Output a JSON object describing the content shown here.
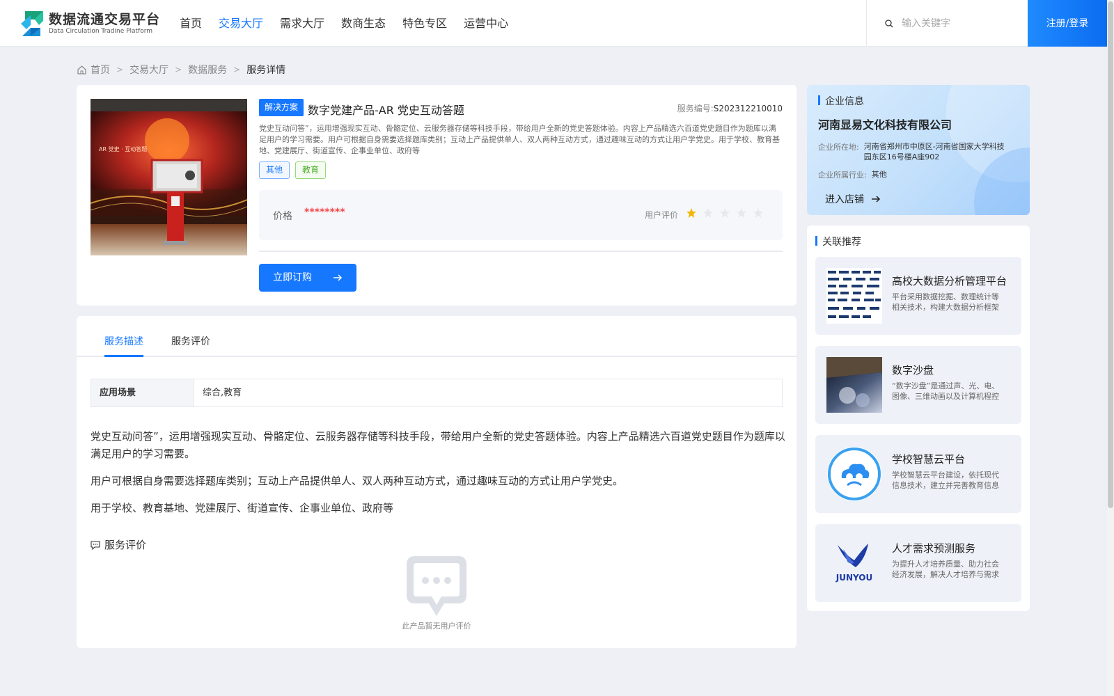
{
  "header": {
    "logo_title": "数据流通交易平台",
    "logo_subtitle": "Data Circulation Tradine Platform",
    "nav": [
      "首页",
      "交易大厅",
      "需求大厅",
      "数商生态",
      "特色专区",
      "运营中心"
    ],
    "active_nav": "交易大厅",
    "search_placeholder": "输入关键字",
    "login_label": "注册/登录"
  },
  "breadcrumb": [
    "首页",
    "交易大厅",
    "数据服务",
    "服务详情"
  ],
  "product": {
    "badge": "解决方案",
    "title": "数字党建产品-AR 党史互动答题",
    "code_label": "服务编号:",
    "code": "S202312210010",
    "description": "党史互动问答”，运用增强现实互动、骨骼定位、云服务器存储等科技手段，带给用户全新的党史答题体验。内容上产品精选六百道党史题目作为题库以满足用户的学习需要。用户可根据自身需要选择题库类别；互动上产品提供单人、双人两种互动方式，通过趣味互动的方式让用户学党史。用于学校、教育基地、党建展厅、街道宣传、企事业单位、政府等",
    "tags": [
      "其他",
      "教育"
    ],
    "price_label": "价格",
    "price": "********",
    "rating_label": "用户评价",
    "rating": 1,
    "rating_max": 5,
    "buy_label": "立即订购"
  },
  "detail": {
    "tabs": [
      "服务描述",
      "服务评价"
    ],
    "active_tab": "服务描述",
    "scene_label": "应用场景",
    "scene_value": "综合,教育",
    "paragraphs": [
      "党史互动问答”，运用增强现实互动、骨骼定位、云服务器存储等科技手段，带给用户全新的党史答题体验。内容上产品精选六百道党史题目作为题库以满足用户的学习需要。",
      "用户可根据自身需要选择题库类别；互动上产品提供单人、双人两种互动方式，通过趣味互动的方式让用户学党史。",
      "用于学校、教育基地、党建展厅、街道宣传、企事业单位、政府等"
    ],
    "review_title": "服务评价",
    "empty_text": "此产品暂无用户评价"
  },
  "company": {
    "section_title": "企业信息",
    "name": "河南显易文化科技有限公司",
    "location_label": "企业所在地:",
    "location": "河南省郑州市中原区-河南省国家大学科技园东区16号楼A座902",
    "industry_label": "企业所属行业:",
    "industry": "其他",
    "enter_label": "进入店铺"
  },
  "recommend": {
    "section_title": "关联推荐",
    "items": [
      {
        "title": "高校大数据分析管理平台",
        "desc": "平台采用数据挖掘、数理统计等相关技术，构建大数据分析框架"
      },
      {
        "title": "数字沙盘",
        "desc": "“数字沙盘”是通过声、光、电、图像、三维动画以及计算机程控技术"
      },
      {
        "title": "学校智慧云平台",
        "desc": "学校智慧云平台建设，依托现代信息技术，建立并完善教育信息化"
      },
      {
        "title": "人才需求预测服务",
        "desc": "为提升人才培养质量、助力社会经济发展，解决人才培养与需求"
      }
    ],
    "logo_text": "JUNYOU"
  },
  "colors": {
    "accent": "#1677ff",
    "price": "#f5484a",
    "star": "#f5b400"
  }
}
